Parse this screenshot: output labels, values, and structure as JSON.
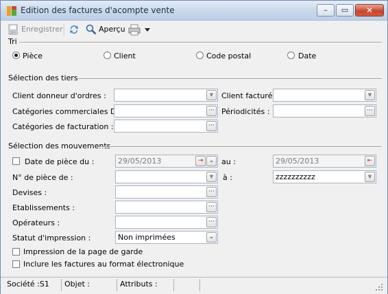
{
  "window": {
    "title": "Edition des factures d'acompte vente",
    "controls": {
      "minimize": "–",
      "maximize": "▭",
      "close": "✕"
    }
  },
  "toolbar": {
    "enregistrer_label": "Enregistrer",
    "apercu_label": "Aperçu"
  },
  "tri": {
    "label": "Tri",
    "options": [
      {
        "label": "Pièce",
        "selected": true
      },
      {
        "label": "Client",
        "selected": false
      },
      {
        "label": "Code postal",
        "selected": false
      },
      {
        "label": "Date",
        "selected": false
      }
    ]
  },
  "tiers": {
    "label": "Sélection des tiers",
    "client_donneur_label": "Client donneur d'ordres :",
    "client_donneur_value": "",
    "client_facture_label": "Client facturé :",
    "client_facture_value": "",
    "categories_commerciales_label": "Catégories commerciales DO :",
    "categories_commerciales_value": "",
    "periodicites_label": "Périodicités :",
    "periodicites_value": "",
    "categories_facturation_label": "Catégories de facturation :",
    "categories_facturation_value": ""
  },
  "mouvements": {
    "label": "Sélection des mouvements",
    "date_piece_label": "Date de pièce du :",
    "date_from": "29/05/2013",
    "au_label": "au :",
    "date_to": "29/05/2013",
    "numero_piece_label": "N° de pièce de :",
    "numero_from": "",
    "a_label": "à :",
    "numero_to": "zzzzzzzzzz",
    "devises_label": "Devises :",
    "devises_value": "",
    "etablissements_label": "Etablissements :",
    "etablissements_value": "",
    "operateurs_label": "Opérateurs :",
    "operateurs_value": "",
    "statut_label": "Statut d'impression :",
    "statut_value": "Non imprimées",
    "impression_garde_label": "Impression de la page de garde",
    "factures_electronique_label": "Inclure les factures au format électronique"
  },
  "status": {
    "societe": "Société :S1",
    "objet": "Objet :",
    "attributs": "Attributs :"
  },
  "icons": {
    "dropdown": "chevron-down-double-icon",
    "ellipsis": "ellipsis-icon",
    "calendar": "calendar-arrow-icon"
  }
}
